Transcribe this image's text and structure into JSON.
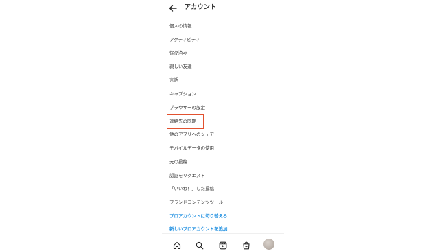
{
  "header": {
    "title": "アカウント",
    "back_icon": "arrow-left-icon"
  },
  "menu": {
    "items": [
      {
        "label": "個人の情報",
        "type": "normal"
      },
      {
        "label": "アクティビティ",
        "type": "normal"
      },
      {
        "label": "保存済み",
        "type": "normal"
      },
      {
        "label": "親しい友達",
        "type": "normal"
      },
      {
        "label": "言語",
        "type": "normal"
      },
      {
        "label": "キャプション",
        "type": "normal"
      },
      {
        "label": "ブラウザーの設定",
        "type": "normal"
      },
      {
        "label": "連絡先の同期",
        "type": "normal"
      },
      {
        "label": "他のアプリへのシェア",
        "type": "normal"
      },
      {
        "label": "モバイルデータの使用",
        "type": "normal"
      },
      {
        "label": "元の投稿",
        "type": "normal"
      },
      {
        "label": "認証をリクエスト",
        "type": "normal"
      },
      {
        "label": "「いいね！」した投稿",
        "type": "normal"
      },
      {
        "label": "ブランドコンテンツツール",
        "type": "normal"
      },
      {
        "label": "プロアカウントに切り替える",
        "type": "link"
      },
      {
        "label": "新しいプロアカウントを追加",
        "type": "link"
      }
    ]
  },
  "highlight": {
    "target": "連絡先の同期",
    "color": "#e2512f"
  },
  "bottom_nav": {
    "icons": [
      "home-icon",
      "search-icon",
      "reels-icon",
      "shop-icon",
      "profile-avatar"
    ]
  },
  "colors": {
    "link": "#1f8fe0",
    "text": "#262626",
    "highlight": "#e2512f"
  }
}
